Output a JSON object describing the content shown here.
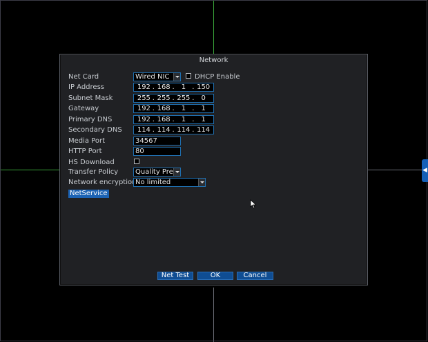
{
  "dialog": {
    "title": "Network"
  },
  "fields": {
    "net_card": {
      "label": "Net Card",
      "value": "Wired NIC"
    },
    "dhcp": {
      "label": "DHCP Enable",
      "checked": false
    },
    "ip_address": {
      "label": "IP Address",
      "octets": [
        "192",
        "168",
        "1",
        "150"
      ]
    },
    "subnet_mask": {
      "label": "Subnet Mask",
      "octets": [
        "255",
        "255",
        "255",
        "0"
      ]
    },
    "gateway": {
      "label": "Gateway",
      "octets": [
        "192",
        "168",
        "1",
        "1"
      ]
    },
    "primary_dns": {
      "label": "Primary DNS",
      "octets": [
        "192",
        "168",
        "1",
        "1"
      ]
    },
    "secondary_dns": {
      "label": "Secondary DNS",
      "octets": [
        "114",
        "114",
        "114",
        "114"
      ]
    },
    "media_port": {
      "label": "Media Port",
      "value": "34567"
    },
    "http_port": {
      "label": "HTTP Port",
      "value": "80"
    },
    "hs_download": {
      "label": "HS Download",
      "checked": false
    },
    "transfer_policy": {
      "label": "Transfer Policy",
      "value": "Quality Prefe"
    },
    "network_encryption": {
      "label": "Network encryption",
      "value": "No limited"
    }
  },
  "netservice_label": "NetService",
  "buttons": {
    "net_test": "Net Test",
    "ok": "OK",
    "cancel": "Cancel"
  },
  "icons": {
    "side_tab": "chevron-left-icon",
    "pointer": "mouse-pointer-icon"
  },
  "colors": {
    "accent": "#1c63b4",
    "field_border": "#1f6fb0",
    "dialog_bg": "#202124"
  }
}
